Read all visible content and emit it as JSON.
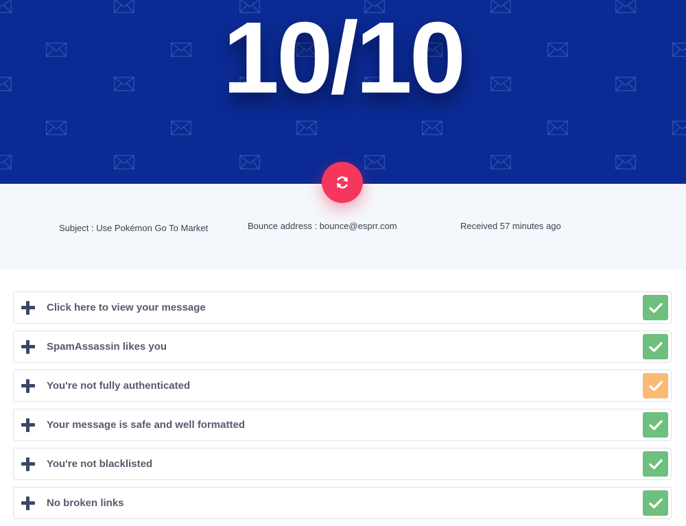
{
  "header": {
    "score": "10/10",
    "background_color": "#0b2a94",
    "pattern_icon": "envelope-icon"
  },
  "refresh_button": {
    "icon": "refresh-icon",
    "color": "#f5375e"
  },
  "info": {
    "subject": "Subject : Use Pokémon Go To Market",
    "bounce": "Bounce address : bounce@esprr.com",
    "received": "Received 57 minutes ago"
  },
  "checks": [
    {
      "label": "Click here to view your message",
      "status": "pass",
      "color": "#6dc07d"
    },
    {
      "label": "SpamAssassin likes you",
      "status": "pass",
      "color": "#6dc07d"
    },
    {
      "label": "You're not fully authenticated",
      "status": "warning",
      "color": "#f9bb73"
    },
    {
      "label": "Your message is safe and well formatted",
      "status": "pass",
      "color": "#6dc07d"
    },
    {
      "label": "You're not blacklisted",
      "status": "pass",
      "color": "#6dc07d"
    },
    {
      "label": "No broken links",
      "status": "pass",
      "color": "#6dc07d"
    }
  ]
}
